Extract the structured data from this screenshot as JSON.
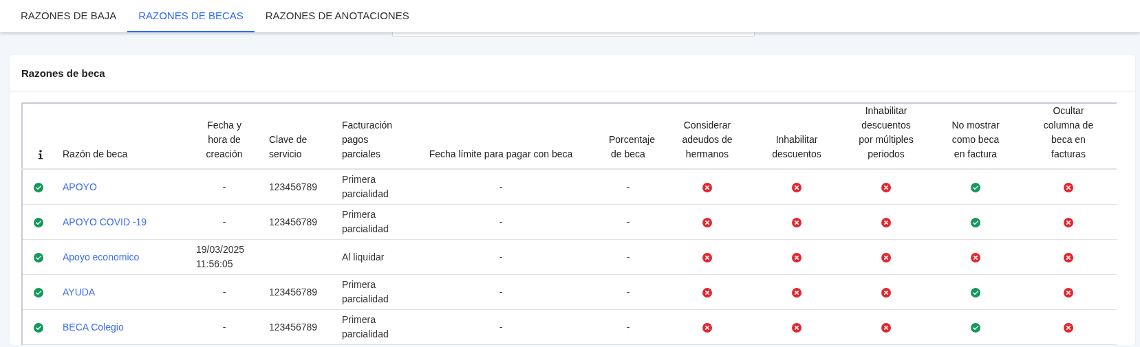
{
  "tabs": [
    {
      "label": "RAZONES DE BAJA",
      "selected": false
    },
    {
      "label": "RAZONES DE BECAS",
      "selected": true
    },
    {
      "label": "RAZONES DE ANOTACIONES",
      "selected": false
    }
  ],
  "card": {
    "title": "Razones de beca"
  },
  "table": {
    "columns": [
      {
        "kind": "info"
      },
      {
        "kind": "name",
        "label": "Razón de beca"
      },
      {
        "kind": "created",
        "label": "Fecha y hora de creación"
      },
      {
        "kind": "key",
        "label": "Clave de servicio"
      },
      {
        "kind": "billing",
        "label": "Facturación pagos parciales"
      },
      {
        "kind": "deadline",
        "label": "Fecha límite para pagar con beca"
      },
      {
        "kind": "percent",
        "label": "Porcentaje de beca"
      },
      {
        "kind": "flag",
        "label": "Considerar adeudos de hermanos"
      },
      {
        "kind": "flag",
        "label": "Inhabilitar descuentos"
      },
      {
        "kind": "flag",
        "label": "Inhabilitar descuentos por múltiples periodos"
      },
      {
        "kind": "flag",
        "label": "No mostrar como beca en factura"
      },
      {
        "kind": "flag",
        "label": "Ocultar columna de beca en facturas"
      }
    ],
    "rows": [
      {
        "active": true,
        "name": "APOYO",
        "created": "-",
        "key": "123456789",
        "billing": "Primera parcialidad",
        "deadline": "-",
        "percent": "-",
        "flags": [
          false,
          false,
          false,
          true,
          false
        ]
      },
      {
        "active": true,
        "name": "APOYO COVID -19",
        "created": "-",
        "key": "123456789",
        "billing": "Primera parcialidad",
        "deadline": "-",
        "percent": "-",
        "flags": [
          false,
          false,
          false,
          true,
          false
        ]
      },
      {
        "active": true,
        "name": "Apoyo economico",
        "created": "19/03/2025 11:56:05",
        "billing": "Al liquidar",
        "deadline": "-",
        "percent": "-",
        "flags": [
          false,
          false,
          false,
          false,
          false
        ]
      },
      {
        "active": true,
        "name": "AYUDA",
        "created": "-",
        "key": "123456789",
        "billing": "Primera parcialidad",
        "deadline": "-",
        "percent": "-",
        "flags": [
          false,
          false,
          false,
          true,
          false
        ]
      },
      {
        "active": true,
        "name": "BECA Colegio",
        "created": "-",
        "key": "123456789",
        "billing": "Primera parcialidad",
        "deadline": "-",
        "percent": "-",
        "flags": [
          false,
          false,
          false,
          true,
          false
        ]
      }
    ]
  }
}
